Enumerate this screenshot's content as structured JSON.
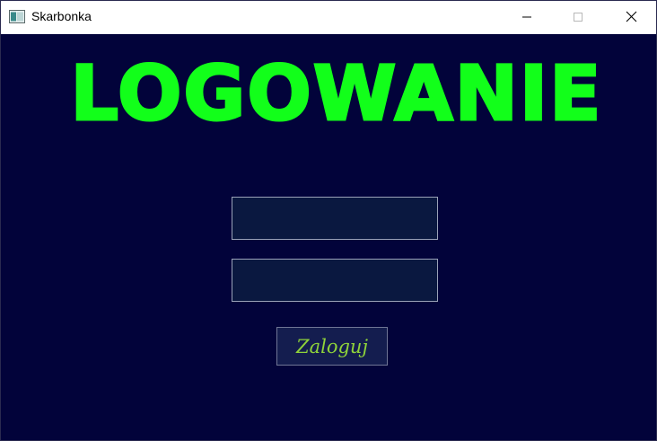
{
  "window": {
    "title": "Skarbonka",
    "controls": [
      "minimize",
      "maximize",
      "close"
    ]
  },
  "main": {
    "heading": "LOGOWANIE",
    "login_field": {
      "value": "",
      "placeholder": ""
    },
    "password_field": {
      "value": "",
      "placeholder": ""
    },
    "login_button_label": "Zaloguj"
  },
  "colors": {
    "background": "#02033a",
    "heading": "#12ff1a",
    "button_text": "#8fd33a",
    "field_background": "#0a1840"
  },
  "icons": {
    "app": "window-app-icon",
    "minimize": "minimize-icon",
    "maximize": "maximize-icon",
    "close": "close-icon"
  }
}
